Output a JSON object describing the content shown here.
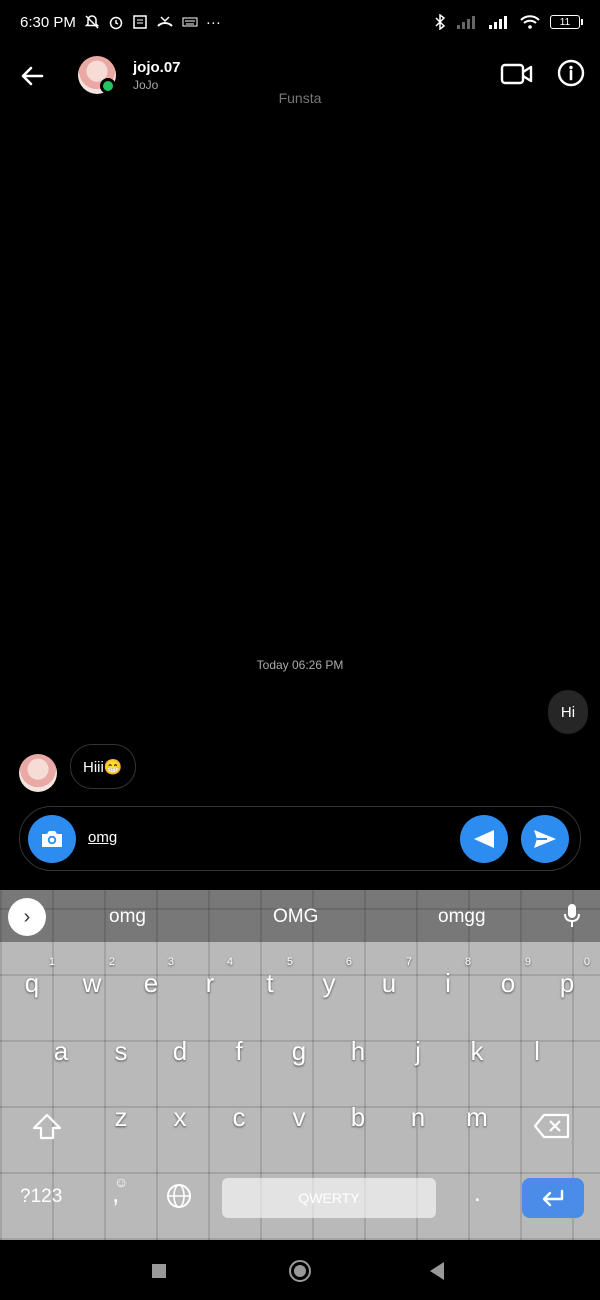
{
  "status_bar": {
    "time": "6:30 PM",
    "dots": "···",
    "battery": "11"
  },
  "header": {
    "username": "jojo.07",
    "display_name": "JoJo",
    "subtitle": "Funsta"
  },
  "conversation": {
    "date_label": "Today 06:26 PM",
    "messages": [
      {
        "direction": "outgoing",
        "text": "Hi"
      },
      {
        "direction": "incoming",
        "text": "Hiii😁"
      }
    ]
  },
  "composer": {
    "value": "omg"
  },
  "keyboard": {
    "suggestions": [
      "omg",
      "OMG",
      "omgg"
    ],
    "row1": [
      "q",
      "w",
      "e",
      "r",
      "t",
      "y",
      "u",
      "i",
      "o",
      "p"
    ],
    "row1_nums": [
      "1",
      "2",
      "3",
      "4",
      "5",
      "6",
      "7",
      "8",
      "9",
      "0"
    ],
    "row2": [
      "a",
      "s",
      "d",
      "f",
      "g",
      "h",
      "j",
      "k",
      "l"
    ],
    "row3": [
      "z",
      "x",
      "c",
      "v",
      "b",
      "n",
      "m"
    ],
    "symbols_label": "?123",
    "comma": ",",
    "space_label": "QWERTY",
    "period": "."
  },
  "colors": {
    "accent": "#2d8cf0",
    "online": "#22c55e",
    "enter": "#4a8de8"
  }
}
